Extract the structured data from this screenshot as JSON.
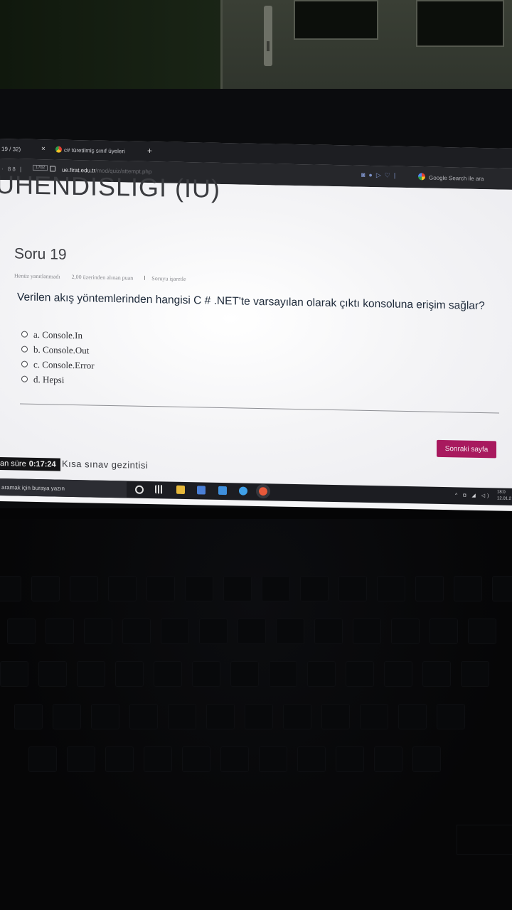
{
  "browser": {
    "tab_counter": "19 / 32)",
    "tab_title": "c# türetilmiş sınıf üyeleri",
    "url_domain": "ue.firat.edu.tr",
    "url_path": "/mod/quiz/attempt.php",
    "search_label": "Google Search ile ara",
    "address_badge": "1782"
  },
  "page": {
    "heading": "UHENDISLIGI (IU)",
    "question_title": "Soru 19",
    "meta": {
      "status": "Henüz yanıtlanmadı",
      "points": "2,00 üzerinden alınan puan",
      "flag": "Soruyu işaretle"
    },
    "question_text": "Verilen akış yöntemlerinden hangisi C # .NET'te varsayılan olarak çıktı konsoluna erişim sağlar?",
    "options": [
      {
        "label": "a. Console.In"
      },
      {
        "label": "b. Console.Out"
      },
      {
        "label": "c. Console.Error"
      },
      {
        "label": "d. Hepsi"
      }
    ],
    "next_button": "Sonraki sayfa",
    "nav_link": "Kısa sınav gezintisi",
    "timer_label": "an süre",
    "timer_value": "0:17:24"
  },
  "taskbar": {
    "search_placeholder": "aramak için buraya yazın",
    "clock_time": "18:0",
    "clock_date": "12.01.2"
  }
}
